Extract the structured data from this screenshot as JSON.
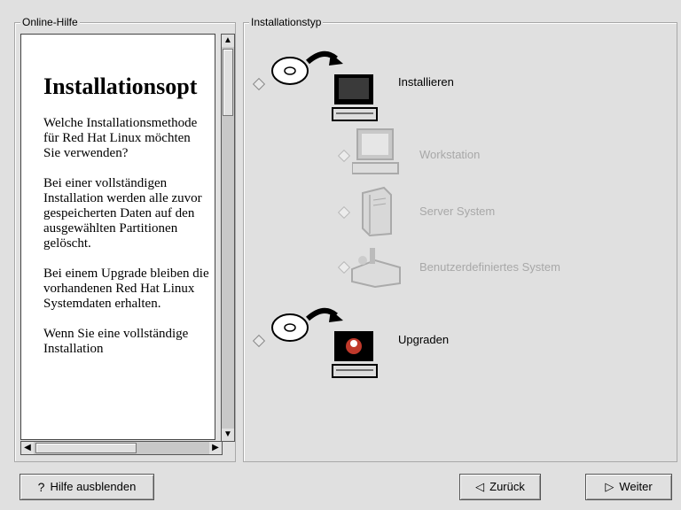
{
  "help_panel": {
    "legend": "Online-Hilfe",
    "heading": "Installationsopt",
    "paragraphs": [
      "Welche Installationsmethode für Red Hat Linux möchten Sie verwenden?",
      "Bei einer vollständigen Installation werden alle zuvor gespeicherten Daten auf den ausgewählten Partitionen gelöscht.",
      "Bei einem Upgrade bleiben die vorhandenen Red Hat Linux Systemdaten erhalten.",
      "Wenn Sie eine vollständige Installation"
    ]
  },
  "type_panel": {
    "legend": "Installationstyp",
    "options": {
      "install": {
        "label": "Installieren",
        "icon": "cd-to-computer-icon",
        "enabled": true
      },
      "workstation": {
        "label": "Workstation",
        "icon": "workstation-icon",
        "enabled": false
      },
      "server": {
        "label": "Server System",
        "icon": "server-tower-icon",
        "enabled": false
      },
      "custom": {
        "label": "Benutzerdefiniertes System",
        "icon": "toolbox-icon",
        "enabled": false
      },
      "upgrade": {
        "label": "Upgraden",
        "icon": "cd-upgrade-computer-icon",
        "enabled": true
      }
    }
  },
  "buttons": {
    "hide_help": "Hilfe ausblenden",
    "back": "Zurück",
    "next": "Weiter"
  },
  "colors": {
    "background": "#e0e0e0",
    "disabled_text": "#a8a8a8"
  }
}
